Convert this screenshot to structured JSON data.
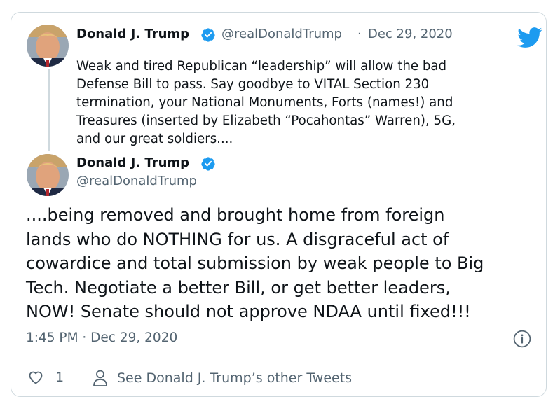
{
  "parent_tweet": {
    "author_name": "Donald J. Trump",
    "handle": "@realDonaldTrump",
    "separator": "·",
    "date": "Dec 29, 2020",
    "text": "Weak and tired Republican “leadership” will allow the bad\nDefense Bill to pass. Say goodbye to VITAL Section 230\ntermination, your National Monuments, Forts (names!) and\nTreasures (inserted by Elizabeth “Pocahontas” Warren), 5G,\nand our great soldiers...."
  },
  "main_tweet": {
    "author_name": "Donald J. Trump",
    "handle": "@realDonaldTrump",
    "text": "....being removed and brought home from foreign\nlands who do NOTHING for us. A disgraceful act of\ncowardice and total submission by weak people to Big\nTech. Negotiate a better Bill, or get better leaders,\nNOW! Senate should not approve NDAA until fixed!!!",
    "timestamp": "1:45 PM · Dec 29, 2020"
  },
  "actions": {
    "like_count": "1",
    "other_tweets_label": "See Donald J. Trump’s other Tweets"
  },
  "icons": {
    "brand": "twitter-bird-icon",
    "verified": "verified-badge-icon",
    "info": "info-icon",
    "like": "heart-icon",
    "profile": "person-icon"
  },
  "colors": {
    "twitter_blue": "#1d9bf0",
    "text_primary": "#0f1419",
    "text_secondary": "#536471",
    "border": "#cfd9de"
  }
}
